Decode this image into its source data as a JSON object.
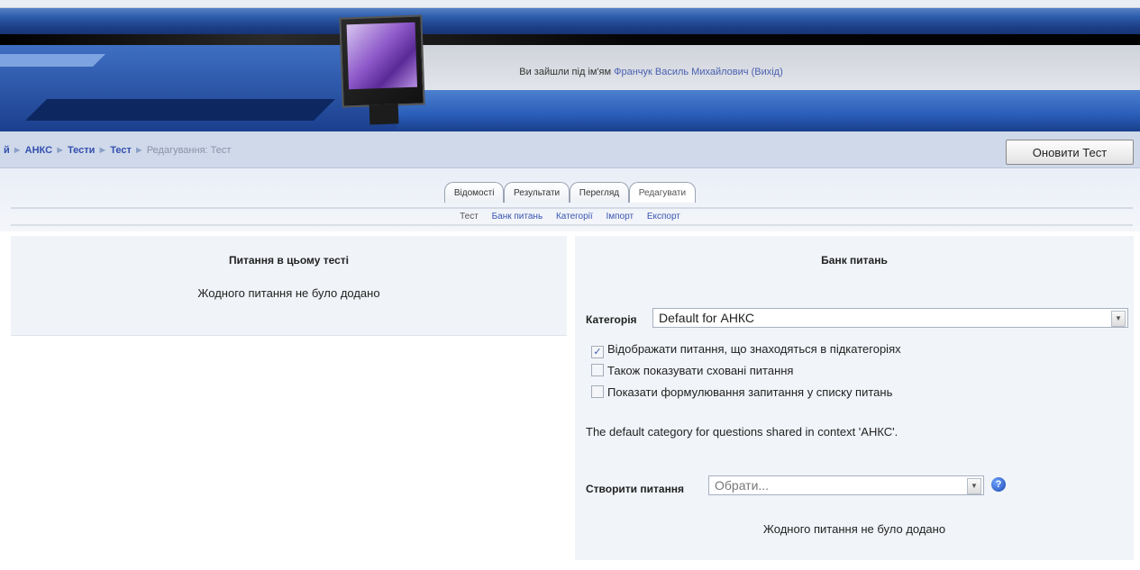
{
  "header": {
    "login_prefix": "Ви зайшли під ім'ям",
    "user_name": "Франчук Василь Михайлович",
    "logout": "(Вихід)"
  },
  "breadcrumb": {
    "items": [
      "й",
      "АНКС",
      "Тести",
      "Тест"
    ],
    "current": "Редагування: Тест",
    "separator": "►"
  },
  "update_button": "Оновити Тест",
  "tabs": [
    {
      "label": "Відомості",
      "active": false
    },
    {
      "label": "Результати",
      "active": false
    },
    {
      "label": "Перегляд",
      "active": false
    },
    {
      "label": "Редагувати",
      "active": true
    }
  ],
  "subtabs": [
    {
      "label": "Тест",
      "link": false
    },
    {
      "label": "Банк питань",
      "link": true
    },
    {
      "label": "Категорії",
      "link": true
    },
    {
      "label": "Імпорт",
      "link": true
    },
    {
      "label": "Експорт",
      "link": true
    }
  ],
  "left_panel": {
    "title": "Питання в цьому тесті",
    "message": "Жодного питання не було додано"
  },
  "right_panel": {
    "title": "Банк питань",
    "category_label": "Категорія",
    "category_value": "Default for АНКС",
    "checkboxes": [
      {
        "label": "Відображати питання, що знаходяться в підкатегоріях",
        "checked": true
      },
      {
        "label": "Також показувати сховані питання",
        "checked": false
      },
      {
        "label": "Показати формулювання запитання у списку питань",
        "checked": false
      }
    ],
    "default_note": "The default category for questions shared in context 'АНКС'.",
    "create_label": "Створити питання",
    "create_placeholder": "Обрати...",
    "help": "?",
    "empty_message": "Жодного питання не було додано"
  }
}
